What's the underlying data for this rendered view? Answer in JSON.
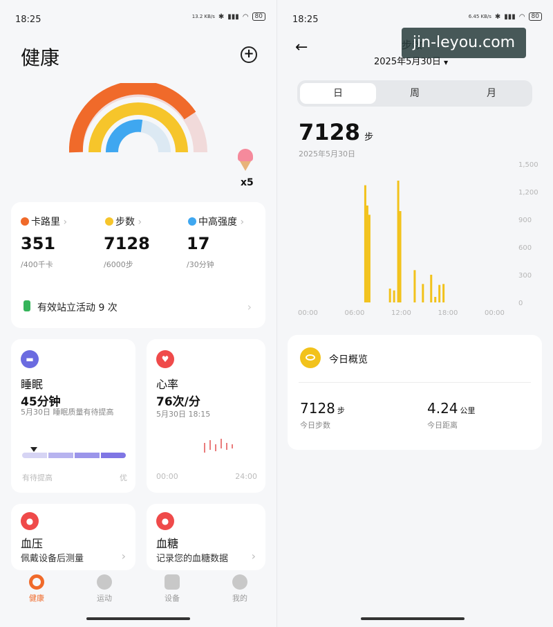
{
  "left": {
    "status": {
      "time": "18:25",
      "net": "13.2 KB/s",
      "battery": "80"
    },
    "title": "健康",
    "badge": "x5",
    "summary": {
      "calories": {
        "label": "卡路里",
        "value": "351",
        "goal": "/400千卡"
      },
      "steps": {
        "label": "步数",
        "value": "7128",
        "goal": "/6000步"
      },
      "intensity": {
        "label": "中高强度",
        "value": "17",
        "goal": "/30分钟"
      },
      "stand": "有效站立活动 9 次"
    },
    "sleep": {
      "title": "睡眠",
      "value": "45分钟",
      "desc": "5月30日 睡眠质量有待提高",
      "left": "有待提高",
      "right": "优"
    },
    "heart": {
      "title": "心率",
      "value": "76次/分",
      "desc": "5月30日 18:15",
      "left": "00:00",
      "right": "24:00"
    },
    "bp": {
      "title": "血压",
      "desc": "佩戴设备后测量"
    },
    "sugar": {
      "title": "血糖",
      "desc": "记录您的血糖数据"
    },
    "nav": [
      "健康",
      "运动",
      "设备",
      "我的"
    ]
  },
  "right": {
    "status": {
      "time": "18:25",
      "net": "6.45 KB/s",
      "battery": "80"
    },
    "title": "步数",
    "date": "2025年5月30日",
    "tabs": [
      "日",
      "周",
      "月"
    ],
    "steps_value": "7128",
    "steps_unit": "步",
    "steps_date": "2025年5月30日",
    "overview_title": "今日概览",
    "ov_steps": {
      "value": "7128",
      "unit": "步",
      "label": "今日步数"
    },
    "ov_dist": {
      "value": "4.24",
      "unit": "公里",
      "label": "今日距离"
    },
    "watermark": "jin-leyou.com"
  },
  "chart_data": {
    "type": "bar",
    "yticks": [
      "1,500",
      "1,200",
      "900",
      "600",
      "300",
      "0"
    ],
    "xticks": [
      "00:00",
      "06:00",
      "12:00",
      "18:00",
      "00:00"
    ],
    "ylim": [
      0,
      1500
    ],
    "series": [
      {
        "x": [
          7.0,
          7.25,
          7.5,
          10.0,
          10.5,
          11.0,
          11.25,
          13.0,
          14.0,
          15.0,
          15.5,
          16.0,
          16.5
        ],
        "values": [
          1270,
          1050,
          950,
          150,
          130,
          1320,
          990,
          350,
          200,
          300,
          60,
          190,
          200
        ]
      }
    ],
    "color": "#f2c21b"
  }
}
